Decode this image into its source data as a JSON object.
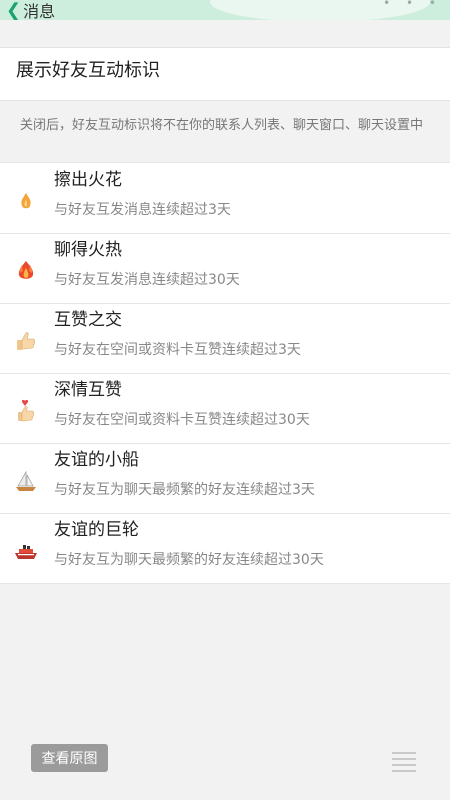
{
  "header": {
    "back_label": "消息"
  },
  "toggle": {
    "label": "展示好友互动标识"
  },
  "description": "关闭后，好友互动标识将不在你的联系人列表、聊天窗口、聊天设置中",
  "items": [
    {
      "icon": "flame-small-icon",
      "title": "擦出火花",
      "subtitle": "与好友互发消息连续超过3天"
    },
    {
      "icon": "flame-big-icon",
      "title": "聊得火热",
      "subtitle": "与好友互发消息连续超过30天"
    },
    {
      "icon": "thumbs-up-icon",
      "title": "互赞之交",
      "subtitle": "与好友在空间或资料卡互赞连续超过3天"
    },
    {
      "icon": "heart-thumb-icon",
      "title": "深情互赞",
      "subtitle": "与好友在空间或资料卡互赞连续超过30天"
    },
    {
      "icon": "sailboat-icon",
      "title": "友谊的小船",
      "subtitle": "与好友互为聊天最频繁的好友连续超过3天"
    },
    {
      "icon": "ship-icon",
      "title": "友谊的巨轮",
      "subtitle": "与好友互为聊天最频繁的好友连续超过30天"
    }
  ],
  "footer": {
    "view_original": "查看原图"
  }
}
